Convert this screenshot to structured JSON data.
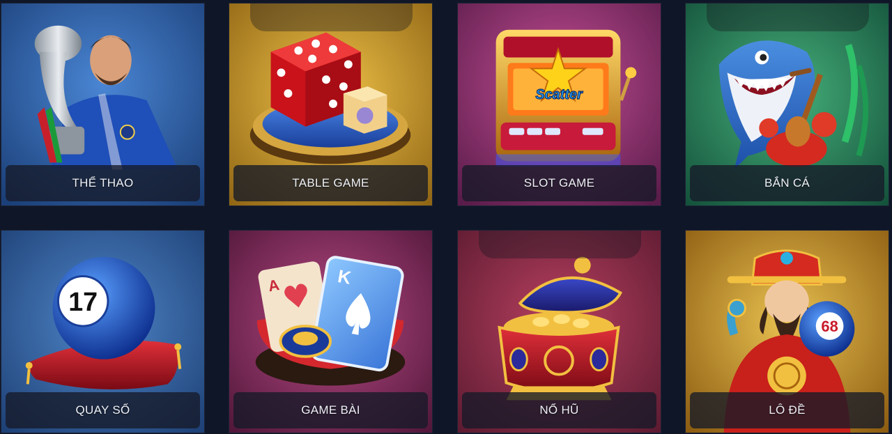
{
  "tiles": [
    {
      "label": "THỂ THAO",
      "icon": "soccer-player-trophy-icon"
    },
    {
      "label": "TABLE GAME",
      "icon": "dice-icon"
    },
    {
      "label": "SLOT GAME",
      "icon": "slot-machine-icon"
    },
    {
      "label": "BẮN CÁ",
      "icon": "shark-icon"
    },
    {
      "label": "QUAY SỐ",
      "icon": "lottery-ball-icon"
    },
    {
      "label": "GAME BÀI",
      "icon": "playing-cards-icon"
    },
    {
      "label": "NỔ HŨ",
      "icon": "treasure-pot-icon"
    },
    {
      "label": "LÔ ĐỀ",
      "icon": "fortune-god-icon"
    }
  ],
  "art": {
    "slot_word": "Scatter",
    "lottery_number": "17",
    "fortune_number": "68"
  },
  "colors": {
    "page_background": "#0f1628",
    "sport_bg": "#2a5aa0",
    "table_bg": "#c59a2c",
    "slot_bg": "#a63c7c",
    "fish_bg": "#2f8a5c",
    "lottery_bg": "#3668a8",
    "cards_bg": "#9a3a6a",
    "jackpot_bg": "#9a3a52",
    "fortune_bg": "#c8a03a"
  }
}
